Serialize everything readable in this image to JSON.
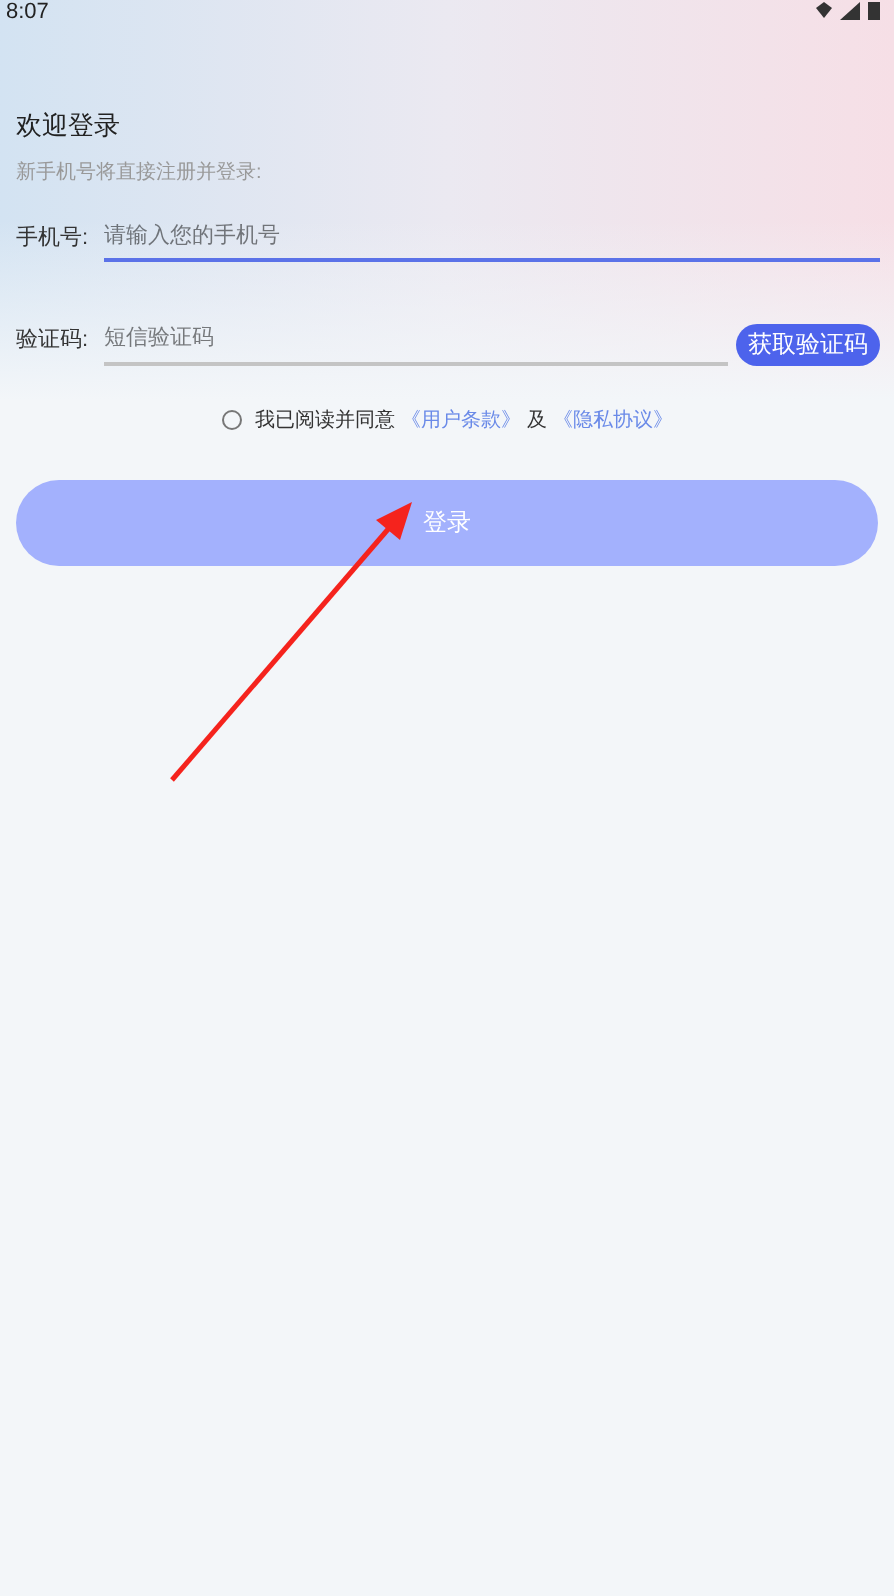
{
  "status_bar": {
    "time": "8:07"
  },
  "title": "欢迎登录",
  "subtitle": "新手机号将直接注册并登录:",
  "fields": [
    {
      "label": "手机号:",
      "placeholder": "请输入您的手机号",
      "focused": true
    },
    {
      "label": "验证码:",
      "placeholder": "短信验证码",
      "focused": false,
      "button": "获取验证码"
    }
  ],
  "agreement": {
    "checked": false,
    "text": "我已阅读并同意",
    "terms": "《用户条款》",
    "joiner": "及",
    "privacy": "《隐私协议》"
  },
  "login_button": {
    "label": "登录"
  }
}
